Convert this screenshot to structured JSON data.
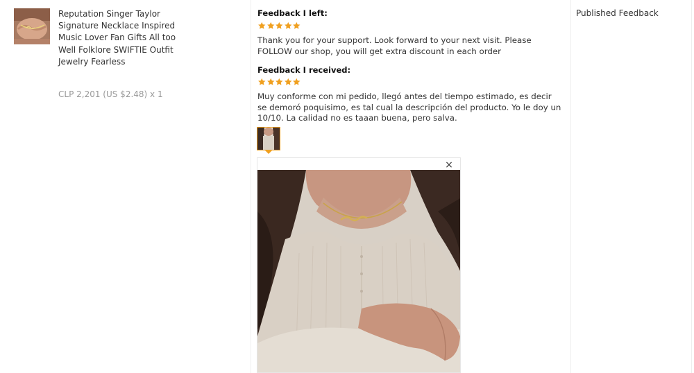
{
  "product": {
    "title": "Reputation Singer Taylor Signature Necklace Inspired Music Lover Fan Gifts All too Well Folklore SWIFTIE Outfit Jewelry Fearless",
    "price": "CLP 2,201 (US $2.48) x 1",
    "thumbnail_icon": "necklace-hand-photo"
  },
  "feedback_left": {
    "heading": "Feedback I left:",
    "rating": 5,
    "text": "Thank you for your support. Look forward to your next visit. Please FOLLOW our shop, you will get extra discount in each order"
  },
  "feedback_received": {
    "heading": "Feedback I received:",
    "rating": 5,
    "text": "Muy conforme con mi pedido, llegó antes del tiempo estimado, es decir se demoró poquisimo, es tal cual la descripción del producto. Yo le doy un 10/10. La calidad no es taaan buena, pero salva.",
    "close_label": "×"
  },
  "status": {
    "label": "Published Feedback"
  },
  "colors": {
    "star": "#f0a020",
    "thumb_border": "#f0a020",
    "price": "#999999",
    "divider": "#eeeeee"
  }
}
